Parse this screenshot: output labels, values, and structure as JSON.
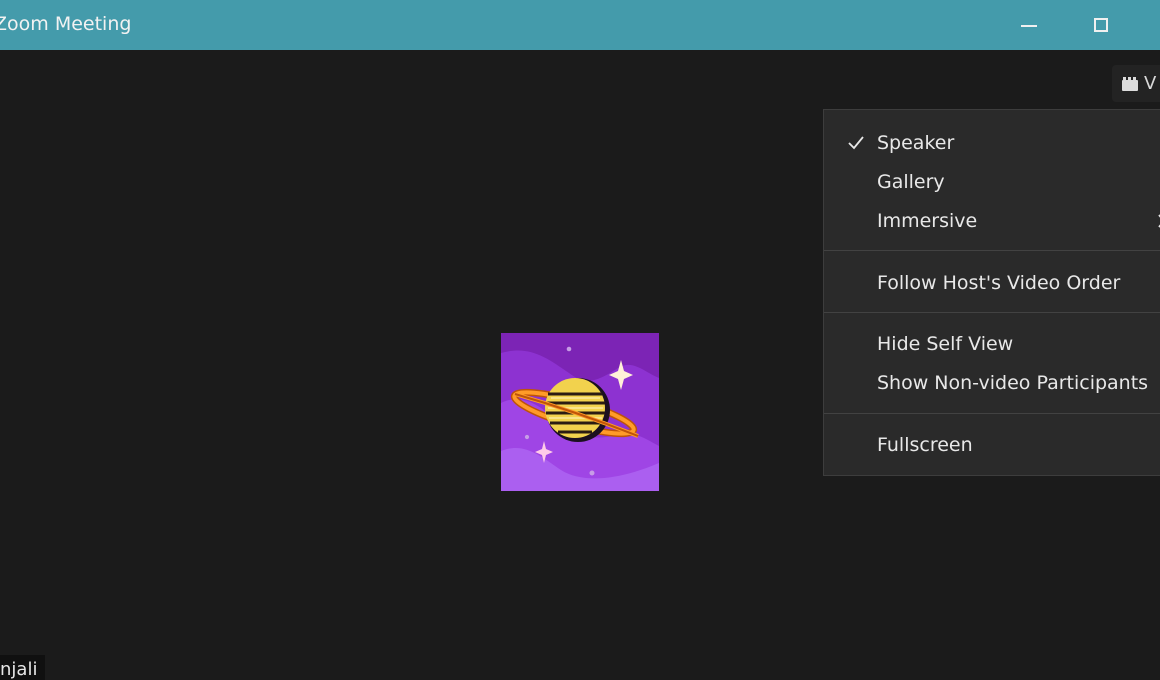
{
  "window": {
    "title": "Zoom Meeting"
  },
  "toolbar": {
    "view_label": "V"
  },
  "view_menu": {
    "items": [
      {
        "label": "Speaker",
        "checked": true
      },
      {
        "label": "Gallery"
      },
      {
        "label": "Immersive"
      },
      {
        "label": "Follow Host's Video Order"
      },
      {
        "label": "Hide Self View"
      },
      {
        "label": "Show Non-video Participants"
      },
      {
        "label": "Fullscreen"
      }
    ]
  },
  "participant": {
    "name_tag": "njali"
  },
  "colors": {
    "titlebar": "#449bab",
    "background": "#1b1b1b",
    "menu_bg": "#2a2a2a",
    "avatar_bg": "#7d22b6",
    "planet_yellow": "#f3c63d",
    "ring_orange": "#ee8a21"
  },
  "icons": {
    "minimize": "minimize-icon",
    "maximize": "maximize-icon",
    "view": "view-grid-icon",
    "check": "check-icon"
  }
}
